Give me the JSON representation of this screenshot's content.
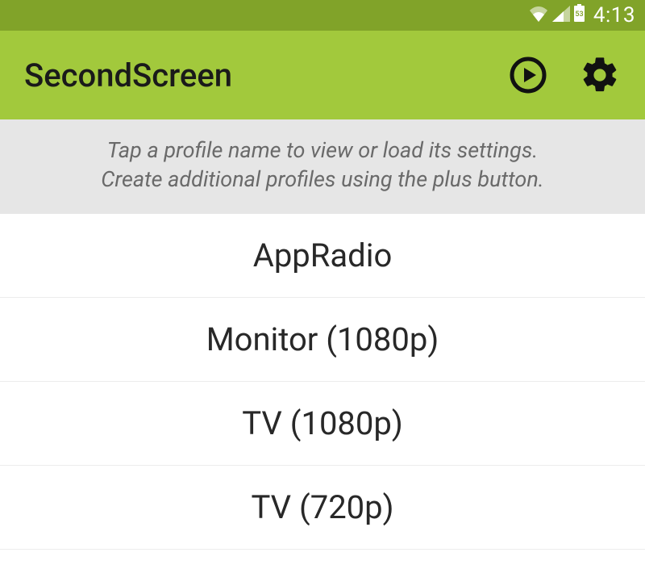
{
  "statusBar": {
    "time": "4:13",
    "batteryLevel": "53"
  },
  "actionBar": {
    "title": "SecondScreen"
  },
  "hint": {
    "line1": "Tap a profile name to view or load its settings.",
    "line2": "Create additional profiles using the plus button."
  },
  "profiles": [
    {
      "label": "AppRadio"
    },
    {
      "label": "Monitor (1080p)"
    },
    {
      "label": "TV (1080p)"
    },
    {
      "label": "TV (720p)"
    }
  ]
}
